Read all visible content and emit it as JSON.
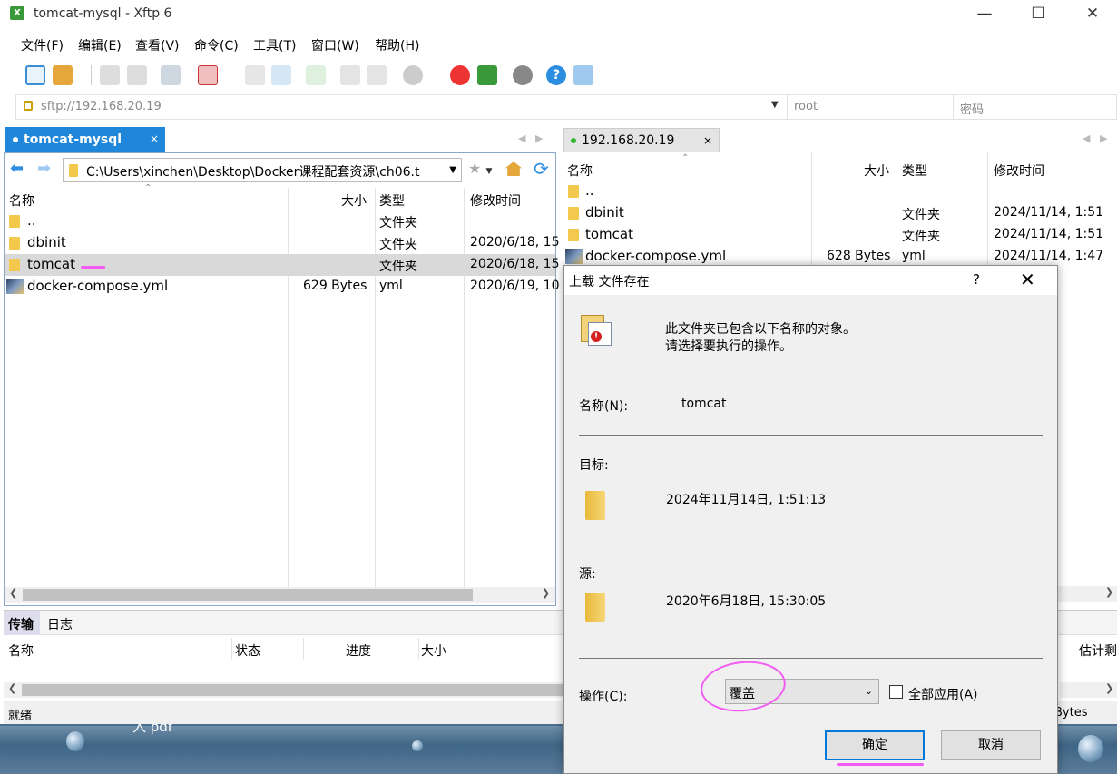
{
  "window": {
    "title": "tomcat-mysql - Xftp 6",
    "min": "—",
    "max": "☐",
    "close": "✕"
  },
  "menu": [
    "文件(F)",
    "编辑(E)",
    "查看(V)",
    "命令(C)",
    "工具(T)",
    "窗口(W)",
    "帮助(H)"
  ],
  "address": {
    "url": "sftp://192.168.20.19",
    "user": "root",
    "password": "密码"
  },
  "left_tab": {
    "label": "tomcat-mysql",
    "close": "×"
  },
  "right_tab": {
    "label": "192.168.20.19",
    "close": "×"
  },
  "left_pane": {
    "path": "C:\\Users\\xinchen\\Desktop\\Docker课程配套资源\\ch06.t",
    "headers": {
      "name": "名称",
      "size": "大小",
      "type": "类型",
      "modified": "修改时间"
    },
    "rows": [
      {
        "name": "..",
        "size": "",
        "type": "文件夹",
        "modified": ""
      },
      {
        "name": "dbinit",
        "size": "",
        "type": "文件夹",
        "modified": "2020/6/18, 15"
      },
      {
        "name": "tomcat",
        "size": "",
        "type": "文件夹",
        "modified": "2020/6/18, 15"
      },
      {
        "name": "docker-compose.yml",
        "size": "629 Bytes",
        "type": "yml",
        "modified": "2020/6/19, 10"
      }
    ]
  },
  "right_pane": {
    "headers": {
      "name": "名称",
      "size": "大小",
      "type": "类型",
      "modified": "修改时间"
    },
    "rows": [
      {
        "name": "..",
        "size": "",
        "type": "",
        "modified": ""
      },
      {
        "name": "dbinit",
        "size": "",
        "type": "文件夹",
        "modified": "2024/11/14, 1:51"
      },
      {
        "name": "tomcat",
        "size": "",
        "type": "文件夹",
        "modified": "2024/11/14, 1:51"
      },
      {
        "name": "docker-compose.yml",
        "size": "628 Bytes",
        "type": "yml",
        "modified": "2024/11/14, 1:47"
      }
    ]
  },
  "transfer": {
    "tabs": [
      "传输",
      "日志"
    ],
    "headers": {
      "name": "名称",
      "status": "状态",
      "progress": "进度",
      "size": "大小",
      "eta": "估计剩"
    }
  },
  "status": {
    "left": "就绪",
    "right": "Bytes"
  },
  "background_text": "入 pdf",
  "dialog": {
    "title": "上载 文件存在",
    "help": "?",
    "close": "✕",
    "message_line1": "此文件夹已包含以下名称的对象。",
    "message_line2": "请选择要执行的操作。",
    "name_label": "名称(N):",
    "name_value": "tomcat",
    "target_label": "目标:",
    "target_date": "2024年11月14日, 1:51:13",
    "source_label": "源:",
    "source_date": "2020年6月18日, 15:30:05",
    "action_label": "操作(C):",
    "action_value": "覆盖",
    "apply_all": "全部应用(A)",
    "ok": "确定",
    "cancel": "取消"
  },
  "colors": {
    "accent": "#1f86d9",
    "annotation": "#f25cf2",
    "folder": "#f2c94c"
  }
}
